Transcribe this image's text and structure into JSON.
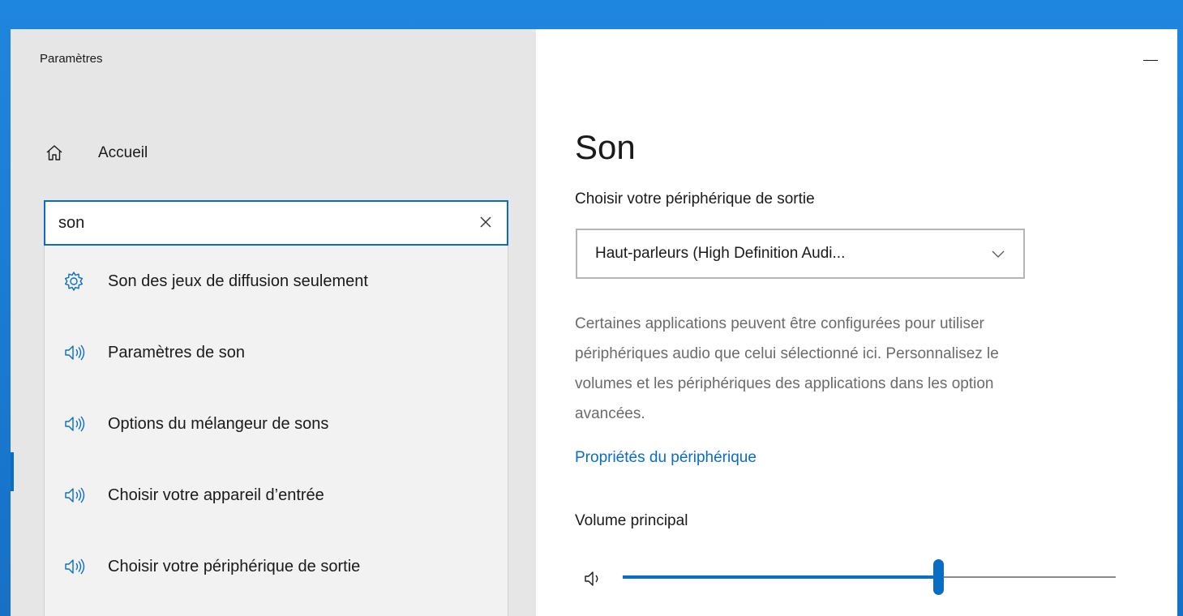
{
  "window": {
    "title": "Paramètres"
  },
  "sidebar": {
    "home_label": "Accueil"
  },
  "search": {
    "value": "son",
    "results": [
      {
        "icon": "gear-icon",
        "label": "Son des jeux de diffusion seulement"
      },
      {
        "icon": "speaker-icon",
        "label": "Paramètres de son"
      },
      {
        "icon": "speaker-icon",
        "label": "Options du mélangeur de sons"
      },
      {
        "icon": "speaker-icon",
        "label": "Choisir votre appareil d’entrée"
      },
      {
        "icon": "speaker-icon",
        "label": "Choisir votre périphérique de sortie"
      }
    ]
  },
  "main": {
    "title": "Son",
    "output_label": "Choisir votre périphérique de sortie",
    "output_device": "Haut-parleurs (High Definition Audi...",
    "description_lines": [
      "Certaines applications peuvent être configurées pour utiliser",
      "périphériques audio que celui sélectionné ici. Personnalisez le",
      "volumes et les périphériques des applications dans les option",
      "avancées."
    ],
    "device_properties_link": "Propriétés du périphérique",
    "volume_label": "Volume principal",
    "volume_level": 0.64
  },
  "colors": {
    "accent": "#0a6dc4",
    "sidebar_bg": "#e6e6e6",
    "desktop": "#1a7ad6"
  }
}
